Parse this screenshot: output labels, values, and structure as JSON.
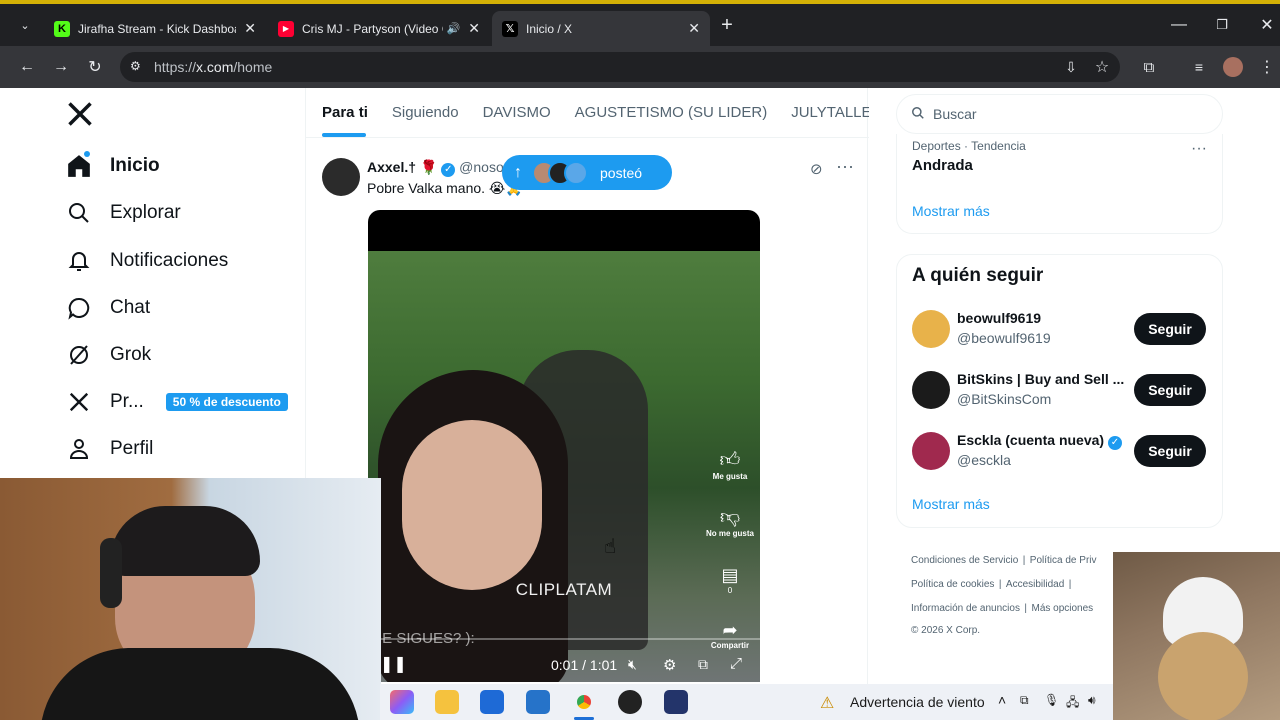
{
  "browser": {
    "tabs": [
      {
        "title": "Jirafha Stream - Kick Dashboarc",
        "favicon": "kick-icon",
        "color": "#53fc18"
      },
      {
        "title": "Cris MJ - Partyson (Video O",
        "favicon": "youtube-icon",
        "color": "#ff0033"
      },
      {
        "title": "Inicio / X",
        "favicon": "x-icon",
        "color": "#000000"
      }
    ],
    "url_scheme": "https://",
    "url_host": "x.com",
    "url_path": "/home"
  },
  "sidebar": {
    "items": [
      {
        "label": "Inicio",
        "icon": "home-icon"
      },
      {
        "label": "Explorar",
        "icon": "search-icon"
      },
      {
        "label": "Notificaciones",
        "icon": "bell-icon"
      },
      {
        "label": "Chat",
        "icon": "chat-icon"
      },
      {
        "label": "Grok",
        "icon": "grok-icon"
      },
      {
        "label": "Pr...",
        "icon": "x-icon"
      },
      {
        "label": "Perfil",
        "icon": "person-icon"
      }
    ],
    "premium_badge": "50 % de descuento"
  },
  "timeline": {
    "tabs": [
      "Para ti",
      "Siguiendo",
      "DAVISMO",
      "AGUSTETISMO (SU LIDER)",
      "JULYTALLEI"
    ],
    "active_tab": "Para ti",
    "new_posts_pill": "posteó",
    "post": {
      "author": "Axxel.†",
      "handle": "@noso",
      "text": "Pobre Valka mano.",
      "video": {
        "watermark": "CLIPLATAM",
        "subtitle": "IE SIGUES? ):",
        "time": "0:01 / 1:01",
        "likes_label": "Me gusta",
        "dislike_label": "No me gusta",
        "comments_count": "0",
        "share_label": "Compartir"
      }
    }
  },
  "right": {
    "search_placeholder": "Buscar",
    "trend_category": "Deportes · Tendencia",
    "trend_name": "Andrada",
    "show_more_1": "Mostrar más",
    "follow_title": "A quién seguir",
    "follow": [
      {
        "name": "beowulf9619",
        "handle": "@beowulf9619",
        "button": "Seguir"
      },
      {
        "name": "BitSkins | Buy and Sell ...",
        "handle": "@BitSkinsCom",
        "button": "Seguir"
      },
      {
        "name": "Esckla (cuenta nueva)",
        "handle": "@esckla",
        "button": "Seguir"
      }
    ],
    "show_more_2": "Mostrar más",
    "footer": {
      "terms": "Condiciones de Servicio",
      "privacy": "Política de Priv",
      "cookies": "Política de cookies",
      "accessibility": "Accesibilidad",
      "ads": "Información de anuncios",
      "more": "Más opciones",
      "copyright": "© 2026 X Corp."
    }
  },
  "taskbar": {
    "weather_text": "Advertencia de viento"
  },
  "colors": {
    "accent": "#1d9bf0",
    "chrome_dark": "#202124",
    "chrome_toolbar": "#35363a"
  }
}
